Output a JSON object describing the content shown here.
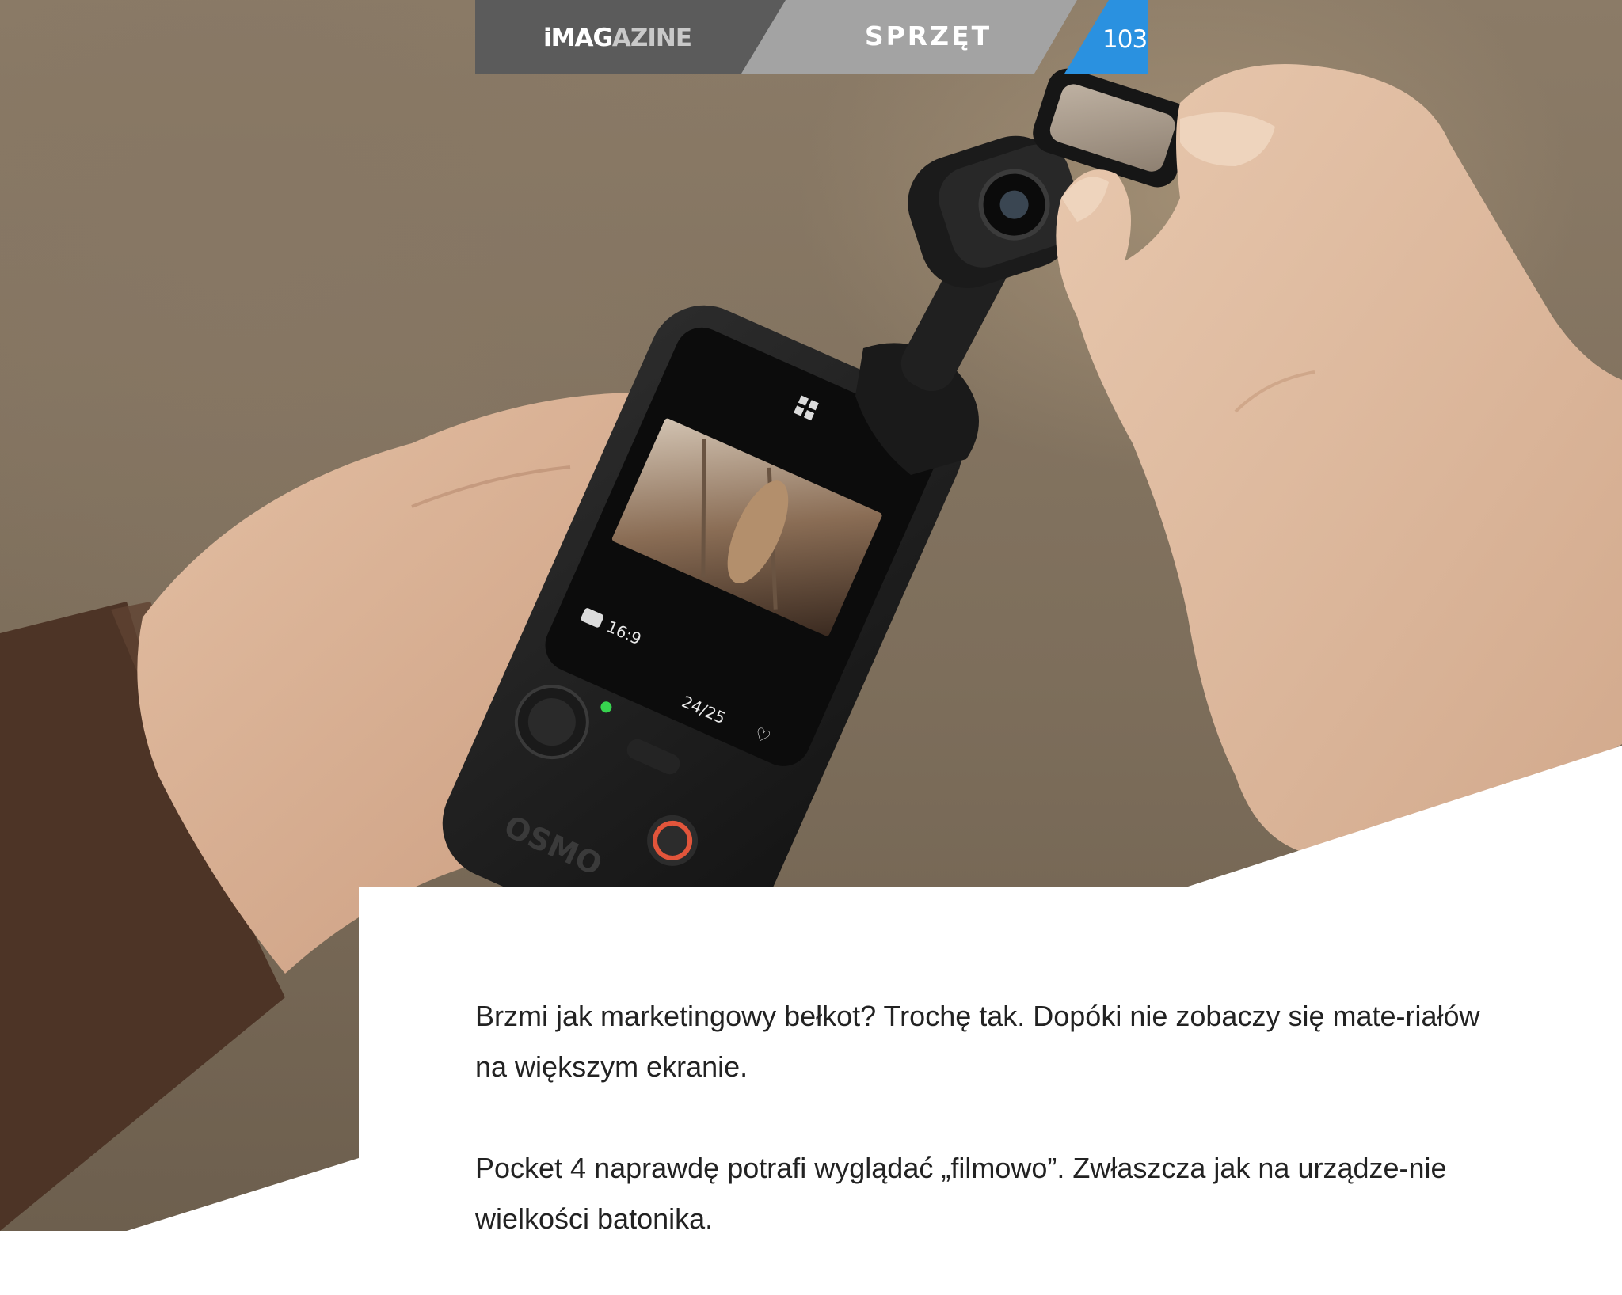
{
  "header": {
    "brand_main": "iMAG",
    "brand_fade": "AZINE",
    "section": "SPRZĘT",
    "page_number": "103"
  },
  "colors": {
    "header_brand_bg": "#5b5b5b",
    "header_section_bg": "#a3a3a3",
    "header_page_bg": "#2a91e0",
    "record_ring": "#e2553b",
    "status_led": "#37d34f"
  },
  "photo": {
    "screen_mode": "16:9",
    "screen_fps": "24/25",
    "device_brand": "OSMO"
  },
  "article": {
    "paragraphs": [
      "Brzmi jak marketingowy bełkot? Trochę tak. Dopóki nie zobaczy się mate-riałów na większym ekranie.",
      "Pocket 4 naprawdę potrafi wyglądać „filmowo”. Zwłaszcza jak na urządze-nie wielkości batonika."
    ]
  }
}
